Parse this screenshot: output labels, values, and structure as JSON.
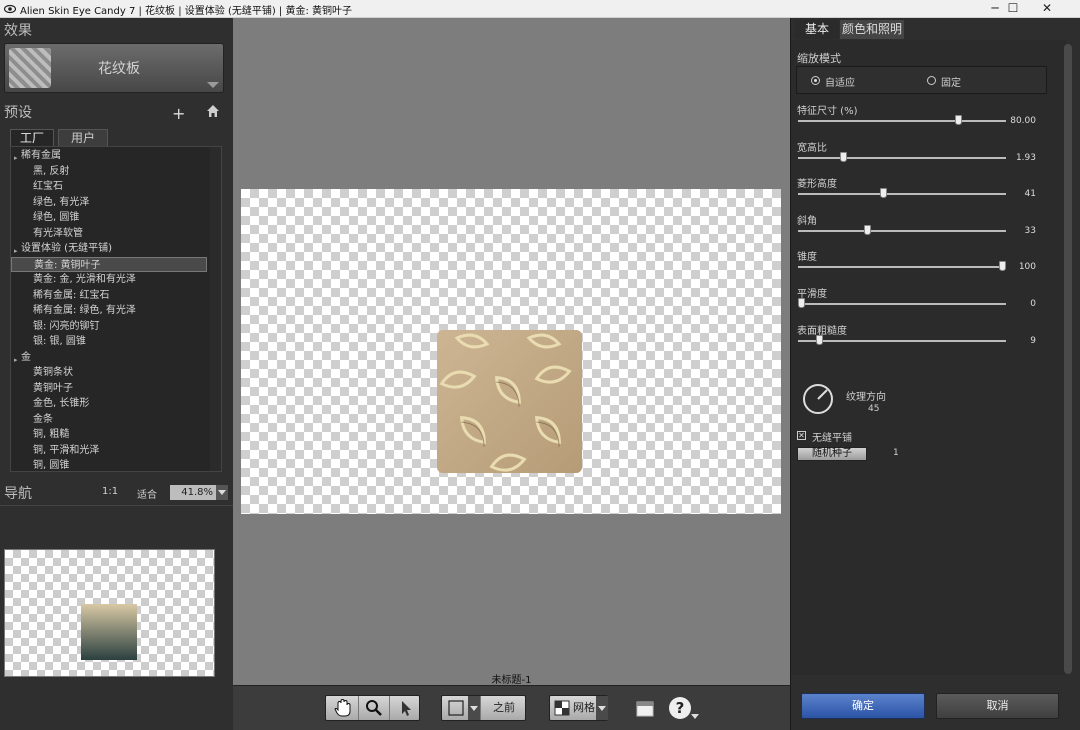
{
  "window": {
    "title": "Alien Skin Eye Candy 7 | 花纹板 | 设置体验 (无缝平铺) | 黄金: 黄铜叶子",
    "minimize": "─",
    "maximize": "☐",
    "close": "✕"
  },
  "left": {
    "effects_title": "效果",
    "effect_name": "花纹板",
    "presets_title": "预设",
    "add_icon": "+",
    "tabs": [
      "工厂",
      "用户"
    ],
    "presets": [
      {
        "type": "cat",
        "label": "稀有金属"
      },
      {
        "type": "item",
        "label": "黑, 反射"
      },
      {
        "type": "item",
        "label": "红宝石"
      },
      {
        "type": "item",
        "label": "绿色, 有光泽"
      },
      {
        "type": "item",
        "label": "绿色, 圆锥"
      },
      {
        "type": "item",
        "label": "有光泽软管"
      },
      {
        "type": "cat",
        "label": "设置体验 (无缝平铺)"
      },
      {
        "type": "item",
        "label": "黄金: 黄铜叶子",
        "selected": true
      },
      {
        "type": "item",
        "label": "黄金: 金, 光滑和有光泽"
      },
      {
        "type": "item",
        "label": "稀有金属: 红宝石"
      },
      {
        "type": "item",
        "label": "稀有金属: 绿色, 有光泽"
      },
      {
        "type": "item",
        "label": "银: 闪亮的铆钉"
      },
      {
        "type": "item",
        "label": "银: 银, 圆锥"
      },
      {
        "type": "cat",
        "label": "金"
      },
      {
        "type": "item",
        "label": "黄铜条状"
      },
      {
        "type": "item",
        "label": "黄铜叶子"
      },
      {
        "type": "item",
        "label": "金色, 长锥形"
      },
      {
        "type": "item",
        "label": "金条"
      },
      {
        "type": "item",
        "label": "铜, 粗糙"
      },
      {
        "type": "item",
        "label": "铜, 平滑和光泽"
      },
      {
        "type": "item",
        "label": "铜, 圆锥"
      }
    ],
    "nav_title": "导航",
    "zoom_1to1": "1:1",
    "zoom_fit": "适合",
    "zoom_value": "41.8%"
  },
  "center": {
    "doc_name": "未标题-1",
    "toolbar": {
      "before": "之前",
      "grid": "网格",
      "help": "?"
    }
  },
  "right": {
    "tabs": [
      "基本",
      "颜色和照明"
    ],
    "scale_mode_label": "缩放模式",
    "scale_options": [
      "自适应",
      "固定"
    ],
    "sliders": [
      {
        "label": "特征尺寸 (%)",
        "value": "80.00",
        "fraction": 0.78
      },
      {
        "label": "宽高比",
        "value": "1.93",
        "fraction": 0.21
      },
      {
        "label": "菱形高度",
        "value": "41",
        "fraction": 0.41
      },
      {
        "label": "斜角",
        "value": "33",
        "fraction": 0.33
      },
      {
        "label": "锥度",
        "value": "100",
        "fraction": 1.0
      },
      {
        "label": "平滑度",
        "value": "0",
        "fraction": 0.0
      },
      {
        "label": "表面粗糙度",
        "value": "9",
        "fraction": 0.09
      }
    ],
    "texture_direction_label": "纹理方向",
    "texture_direction_value": "45",
    "seamless_label": "无缝平铺",
    "random_seed_button": "随机种子",
    "random_seed_value": "1",
    "ok": "确定",
    "cancel": "取消"
  }
}
